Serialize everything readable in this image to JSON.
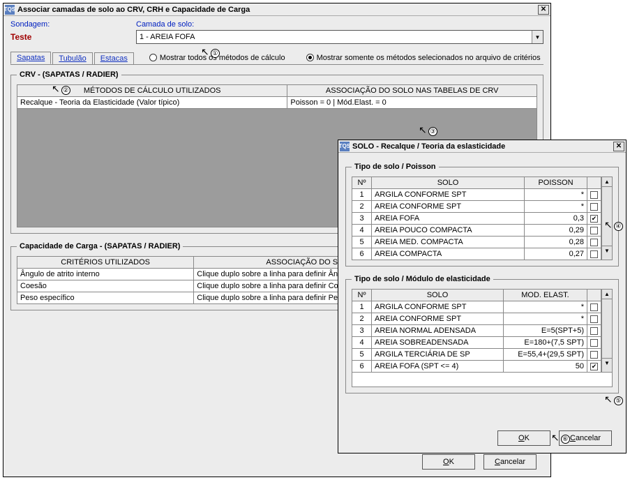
{
  "main": {
    "title": "Associar camadas de solo ao CRV,  CRH e Capacidade de Carga",
    "icon_text": "TQS",
    "sondagem_label": "Sondagem:",
    "sondagem_value": "Teste",
    "camada_label": "Camada de solo:",
    "camada_value": "1 - AREIA FOFA",
    "tabs": {
      "sapatas": "Sapatas",
      "tubulao": "Tubulão",
      "estacas": "Estacas"
    },
    "radio_all": "Mostrar todos os métodos de cálculo",
    "radio_sel": "Mostrar somente os métodos selecionados no arquivo de critérios",
    "crv": {
      "legend": "CRV - (SAPATAS / RADIER)",
      "h1": "MÉTODOS DE CÁLCULO UTILIZADOS",
      "h2": "ASSOCIAÇÃO DO SOLO NAS TABELAS DE CRV",
      "row1c1": "Recalque - Teoria da Elasticidade (Valor típico)",
      "row1c2": "Poisson = 0  |  Mód.Elast. = 0"
    },
    "cap": {
      "legend": "Capacidade de Carga - (SAPATAS / RADIER)",
      "h1": "CRITÉRIOS UTILIZADOS",
      "h2": "ASSOCIAÇÃO DO SOLO NAS TABELAS DE CRITÉRIOS",
      "rows": [
        {
          "c1": "Ângulo de atrito interno",
          "c2": "Clique duplo sobre a linha para definir Ângulo de atrito..."
        },
        {
          "c1": "Coesão",
          "c2": "Clique duplo sobre a linha para definir Coesão..."
        },
        {
          "c1": "Peso específico",
          "c2": "Clique duplo sobre a linha para definir Peso Específico..."
        }
      ]
    },
    "ok": "OK",
    "cancel": "Cancelar"
  },
  "sub": {
    "title": "SOLO - Recalque / Teoria da eslasticidade",
    "icon_text": "TQS",
    "poisson": {
      "legend": "Tipo de solo / Poisson",
      "h_n": "Nº",
      "h_solo": "SOLO",
      "h_val": "POISSON",
      "rows": [
        {
          "n": "1",
          "solo": "ARGILA CONFORME SPT",
          "val": "*",
          "chk": false
        },
        {
          "n": "2",
          "solo": "AREIA CONFORME SPT",
          "val": "*",
          "chk": false
        },
        {
          "n": "3",
          "solo": "AREIA FOFA",
          "val": "0,3",
          "chk": true
        },
        {
          "n": "4",
          "solo": "AREIA POUCO COMPACTA",
          "val": "0,29",
          "chk": false
        },
        {
          "n": "5",
          "solo": "AREIA MED. COMPACTA",
          "val": "0,28",
          "chk": false
        },
        {
          "n": "6",
          "solo": "AREIA COMPACTA",
          "val": "0,27",
          "chk": false
        }
      ]
    },
    "modulo": {
      "legend": "Tipo de solo / Módulo de elasticidade",
      "h_n": "Nº",
      "h_solo": "SOLO",
      "h_val": "MOD. ELAST.",
      "rows": [
        {
          "n": "1",
          "solo": "ARGILA CONFORME SPT",
          "val": "*",
          "chk": false
        },
        {
          "n": "2",
          "solo": "AREIA CONFORME SPT",
          "val": "*",
          "chk": false
        },
        {
          "n": "3",
          "solo": "AREIA NORMAL ADENSADA",
          "val": "E=5(SPT+5)",
          "chk": false
        },
        {
          "n": "4",
          "solo": "AREIA SOBREADENSADA",
          "val": "E=180+(7,5 SPT)",
          "chk": false
        },
        {
          "n": "5",
          "solo": "ARGILA TERCIÁRIA DE SP",
          "val": "E=55,4+(29,5 SPT)",
          "chk": false
        },
        {
          "n": "6",
          "solo": "AREIA FOFA (SPT <= 4)",
          "val": "50",
          "chk": true
        }
      ]
    },
    "ok": "OK",
    "cancel": "Cancelar"
  },
  "pointers": {
    "p1": "①",
    "p2": "②",
    "p3": "③",
    "p4": "④",
    "p5": "⑤",
    "p6": "⑥"
  }
}
